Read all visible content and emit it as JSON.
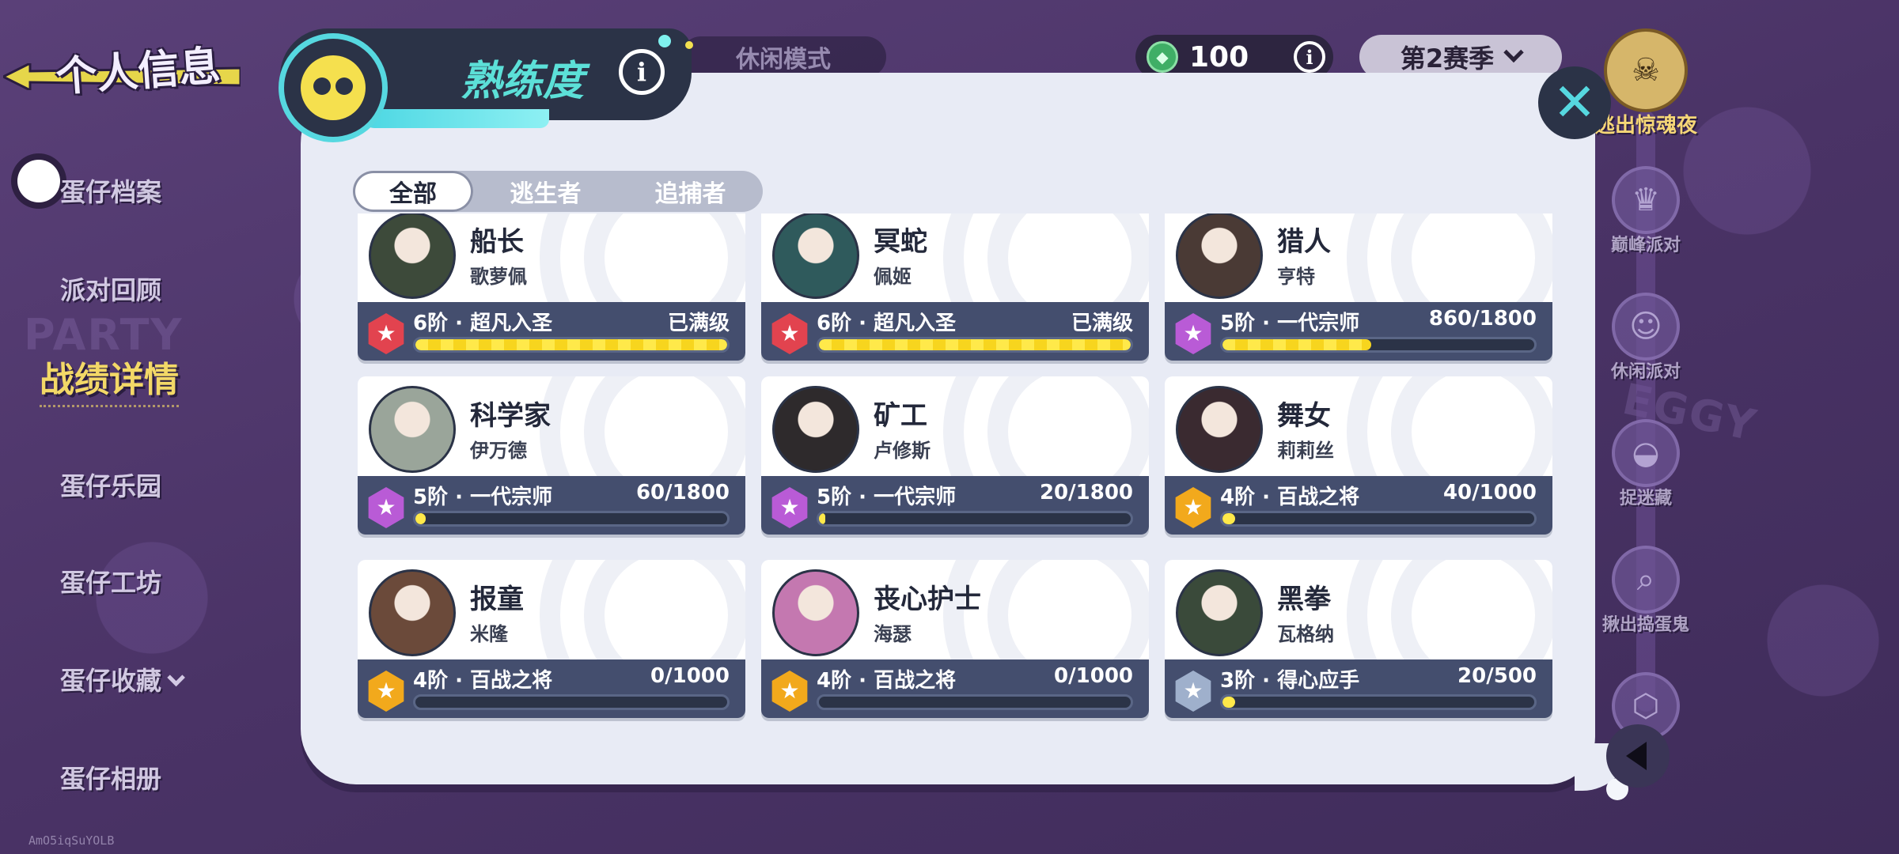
{
  "header": {
    "page_title": "个人信息",
    "panel_title": "熟练度",
    "mode_tab": "休闲模式",
    "coins": "100",
    "season": "第2赛季"
  },
  "nav": {
    "items": [
      {
        "label": "蛋仔档案"
      },
      {
        "label": "派对回顾"
      },
      {
        "label": "战绩详情"
      },
      {
        "label": "蛋仔乐园"
      },
      {
        "label": "蛋仔工坊"
      },
      {
        "label": "蛋仔收藏"
      },
      {
        "label": "蛋仔相册"
      }
    ],
    "active": "战绩详情"
  },
  "right_modes": [
    {
      "label": "逃出惊魂夜",
      "icon": "skull-icon"
    },
    {
      "label": "巅峰派对",
      "icon": "crown-icon"
    },
    {
      "label": "休闲派对",
      "icon": "ghost-icon"
    },
    {
      "label": "捉迷藏",
      "icon": "ufo-icon"
    },
    {
      "label": "揪出捣蛋鬼",
      "icon": "magnifier-icon"
    }
  ],
  "filters": [
    {
      "label": "全部",
      "active": true
    },
    {
      "label": "逃生者",
      "active": false
    },
    {
      "label": "追捕者",
      "active": false
    }
  ],
  "characters": [
    {
      "name": "船长",
      "player": "歌萝佩",
      "rank": "6阶 · 超凡入圣",
      "progress_text": "已满级",
      "progress": 1.0,
      "tier": "red",
      "avatar_color": "#3d4a3a"
    },
    {
      "name": "冥蛇",
      "player": "佩姬",
      "rank": "6阶 · 超凡入圣",
      "progress_text": "已满级",
      "progress": 1.0,
      "tier": "red",
      "avatar_color": "#2f5a5c"
    },
    {
      "name": "猎人",
      "player": "亨特",
      "rank": "5阶 · 一代宗师",
      "progress_text": "860/1800",
      "progress": 0.478,
      "tier": "purple",
      "avatar_color": "#4a3a35"
    },
    {
      "name": "科学家",
      "player": "伊万德",
      "rank": "5阶 · 一代宗师",
      "progress_text": "60/1800",
      "progress": 0.033,
      "tier": "purple",
      "avatar_color": "#9aa59a"
    },
    {
      "name": "矿工",
      "player": "卢修斯",
      "rank": "5阶 · 一代宗师",
      "progress_text": "20/1800",
      "progress": 0.011,
      "tier": "purple",
      "avatar_color": "#2e2a2c"
    },
    {
      "name": "舞女",
      "player": "莉莉丝",
      "rank": "4阶 · 百战之将",
      "progress_text": "40/1000",
      "progress": 0.04,
      "tier": "gold",
      "avatar_color": "#3a2a30"
    },
    {
      "name": "报童",
      "player": "米隆",
      "rank": "4阶 · 百战之将",
      "progress_text": "0/1000",
      "progress": 0.0,
      "tier": "gold",
      "avatar_color": "#6b4a3a"
    },
    {
      "name": "丧心护士",
      "player": "海瑟",
      "rank": "4阶 · 百战之将",
      "progress_text": "0/1000",
      "progress": 0.0,
      "tier": "gold",
      "avatar_color": "#c478b0"
    },
    {
      "name": "黑拳",
      "player": "瓦格纳",
      "rank": "3阶 · 得心应手",
      "progress_text": "20/500",
      "progress": 0.04,
      "tier": "silver",
      "avatar_color": "#3a4a3a"
    }
  ],
  "tier_colors": {
    "red": "#e2434f",
    "purple": "#b95bd6",
    "gold": "#f2a91c",
    "silver": "#9fb0cc"
  },
  "footer": {
    "id_text": "AmO5iqSuYOLB"
  }
}
